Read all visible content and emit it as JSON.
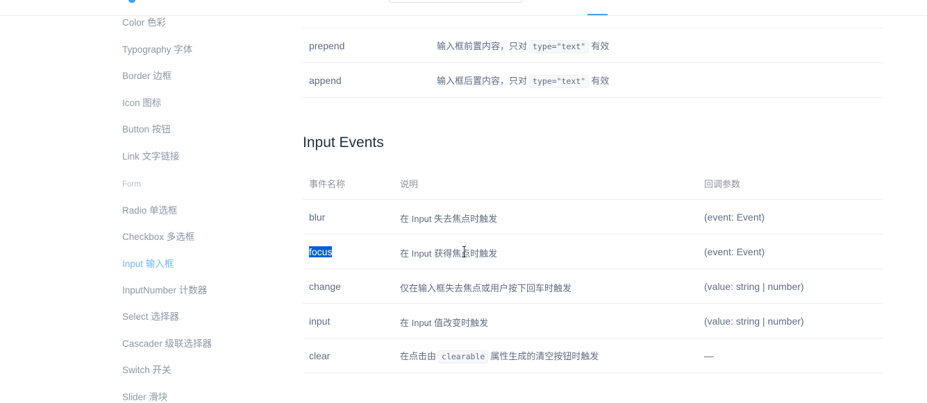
{
  "sidebar": {
    "items": [
      {
        "label": "Color 色彩"
      },
      {
        "label": "Typography 字体"
      },
      {
        "label": "Border 边框"
      },
      {
        "label": "Icon 图标"
      },
      {
        "label": "Button 按钮"
      },
      {
        "label": "Link 文字链接"
      }
    ],
    "group_label": "Form",
    "form_items": [
      {
        "label": "Radio 单选框"
      },
      {
        "label": "Checkbox 多选框"
      },
      {
        "label": "Input 输入框"
      },
      {
        "label": "InputNumber 计数器"
      },
      {
        "label": "Select 选择器"
      },
      {
        "label": "Cascader 级联选择器"
      },
      {
        "label": "Switch 开关"
      },
      {
        "label": "Slider 滑块"
      }
    ],
    "active_item": "Input 输入框"
  },
  "attributes_table": {
    "rows": [
      {
        "name": "prepend",
        "desc_before": "输入框前置内容，只对",
        "code": "type=\"text\"",
        "desc_after": "有效"
      },
      {
        "name": "append",
        "desc_before": "输入框后置内容，只对",
        "code": "type=\"text\"",
        "desc_after": "有效"
      }
    ]
  },
  "events": {
    "title": "Input Events",
    "headers": [
      "事件名称",
      "说明",
      "回调参数"
    ],
    "rows": [
      {
        "name": "blur",
        "desc": "在 Input 失去焦点时触发",
        "params": "(event: Event)"
      },
      {
        "name": "focus",
        "desc": "在 Input 获得焦点时触发",
        "params": "(event: Event)"
      },
      {
        "name": "change",
        "desc": "仅在输入框失去焦点或用户按下回车时触发",
        "params": "(value: string | number)"
      },
      {
        "name": "input",
        "desc": "在 Input 值改变时触发",
        "params": "(value: string | number)"
      },
      {
        "name": "clear",
        "desc_before": "在点击由",
        "code": "clearable",
        "desc_after": "属性生成的清空按钮时触发",
        "params": "—"
      }
    ],
    "selected_row": "focus"
  },
  "colors": {
    "accent": "#409eff",
    "selection": "#0a5fd6",
    "text": "#5e6d82",
    "border": "#ebeef5"
  }
}
